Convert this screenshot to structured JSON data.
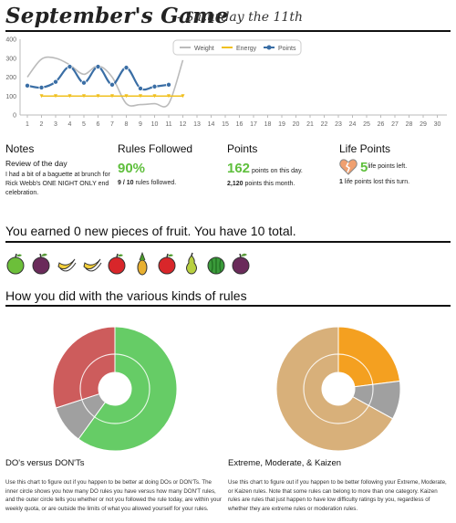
{
  "header": {
    "title": "September's Game",
    "subtitle": "- Saturday the 11th"
  },
  "chart_data": {
    "type": "line",
    "x": [
      1,
      2,
      3,
      4,
      5,
      6,
      7,
      8,
      9,
      10,
      11,
      12,
      13,
      14,
      15,
      16,
      17,
      18,
      19,
      20,
      21,
      22,
      23,
      24,
      25,
      26,
      27,
      28,
      29,
      30
    ],
    "ylim": [
      0,
      400
    ],
    "yticks": [
      0,
      100,
      200,
      300,
      400
    ],
    "grid": false,
    "legend_position": "top-right",
    "series": [
      {
        "name": "Weight",
        "color": "#bbbbbb",
        "x": [
          1,
          2,
          3,
          4,
          5,
          6,
          7,
          8,
          9,
          10,
          11,
          12
        ],
        "values": [
          200,
          295,
          300,
          265,
          215,
          260,
          200,
          60,
          55,
          60,
          60,
          290
        ]
      },
      {
        "name": "Energy",
        "color": "#f0c020",
        "x": [
          2,
          3,
          4,
          5,
          6,
          7,
          8,
          9,
          10,
          11,
          12
        ],
        "values": [
          100,
          100,
          100,
          100,
          100,
          100,
          100,
          100,
          100,
          100,
          100
        ]
      },
      {
        "name": "Points",
        "color": "#3a6ea5",
        "x": [
          1,
          2,
          3,
          4,
          5,
          6,
          7,
          8,
          9,
          10,
          11
        ],
        "values": [
          155,
          145,
          175,
          255,
          170,
          255,
          160,
          250,
          140,
          150,
          160
        ]
      }
    ]
  },
  "columns": {
    "notes": {
      "heading": "Notes",
      "subheading": "Review of the day",
      "text": "I had a bit of a baguette at brunch for Rick Webb's ONE NIGHT ONLY end celebration."
    },
    "rules": {
      "heading": "Rules Followed",
      "percent": "90%",
      "count_bold": "9 / 10",
      "count_text": " rules followed."
    },
    "points": {
      "heading": "Points",
      "day_value": "162",
      "day_text": " points on this day.",
      "month_value": "2,120",
      "month_text": " points this month."
    },
    "life": {
      "heading": "Life Points",
      "left_value": "5",
      "left_text": " life points left.",
      "lost_value": "1",
      "lost_text": " life points lost this turn."
    }
  },
  "fruit_section": {
    "heading": "You earned 0 new pieces of fruit. You have 10 total.",
    "fruits": [
      "apple-icon",
      "plum-icon",
      "banana-icon",
      "banana-icon",
      "apple-icon",
      "pineapple-icon",
      "apple-icon",
      "pear-icon",
      "watermelon-icon",
      "plum-icon"
    ]
  },
  "rules_section": {
    "heading": "How you did with the various kinds of rules",
    "left": {
      "title": "DO's versus DON'Ts",
      "desc": "Use this chart to figure out if you happen to be better at doing DOs or DON'Ts. The inner circle shows you how many DO rules you have versus how many DON'T rules, and the outer circle tells you whether or not you followed the rule today, are within your weekly quota, or are outside the limits of what you allowed yourself for your rules."
    },
    "right": {
      "title": "Extreme, Moderate, & Kaizen",
      "desc": "Use this chart to figure out if you happen to be better following your Extreme, Moderate, or Kaizen rules. Note that some rules can belong to more than one category. Kaizen rules are rules that just happen to have low difficulty ratings by you, regardless of whether they are extreme rules or moderation rules."
    }
  },
  "donuts": [
    {
      "name": "dos-donts",
      "segments": [
        {
          "value": 60,
          "color": "#66cc66"
        },
        {
          "value": 10,
          "color": "#a0a0a0"
        },
        {
          "value": 30,
          "color": "#cd5c5c"
        }
      ]
    },
    {
      "name": "extreme-moderate-kaizen",
      "segments": [
        {
          "value": 23,
          "color": "#f4a020"
        },
        {
          "value": 10,
          "color": "#a0a0a0"
        },
        {
          "value": 67,
          "color": "#d8b07a"
        }
      ]
    }
  ]
}
